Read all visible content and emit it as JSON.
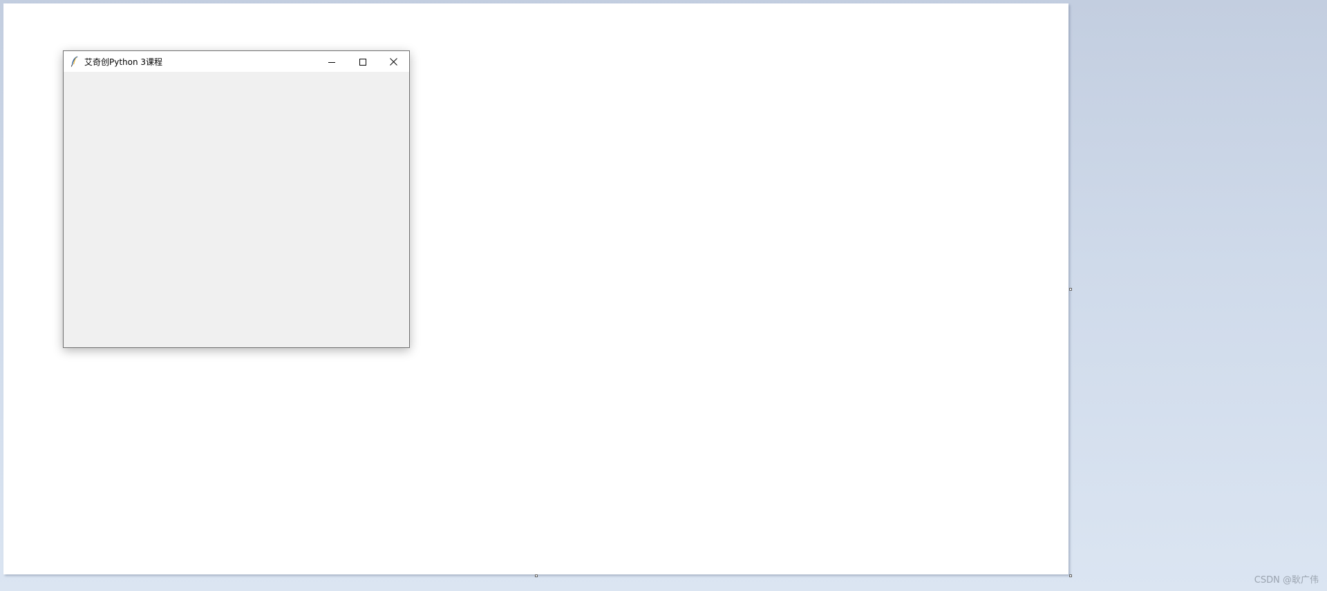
{
  "window": {
    "title": "艾奇创Python 3课程",
    "app_icon": "tk-feather-icon",
    "controls": {
      "minimize_icon": "minimize-icon",
      "maximize_icon": "maximize-icon",
      "close_icon": "close-icon"
    }
  },
  "watermark": {
    "text": "CSDN @耿广伟"
  },
  "colors": {
    "desktop_top": "#c3cee0",
    "desktop_bottom": "#dbe5f2",
    "canvas": "#ffffff",
    "window_client": "#f0f0f0",
    "titlebar": "#ffffff",
    "close_hover": "#e81123"
  }
}
